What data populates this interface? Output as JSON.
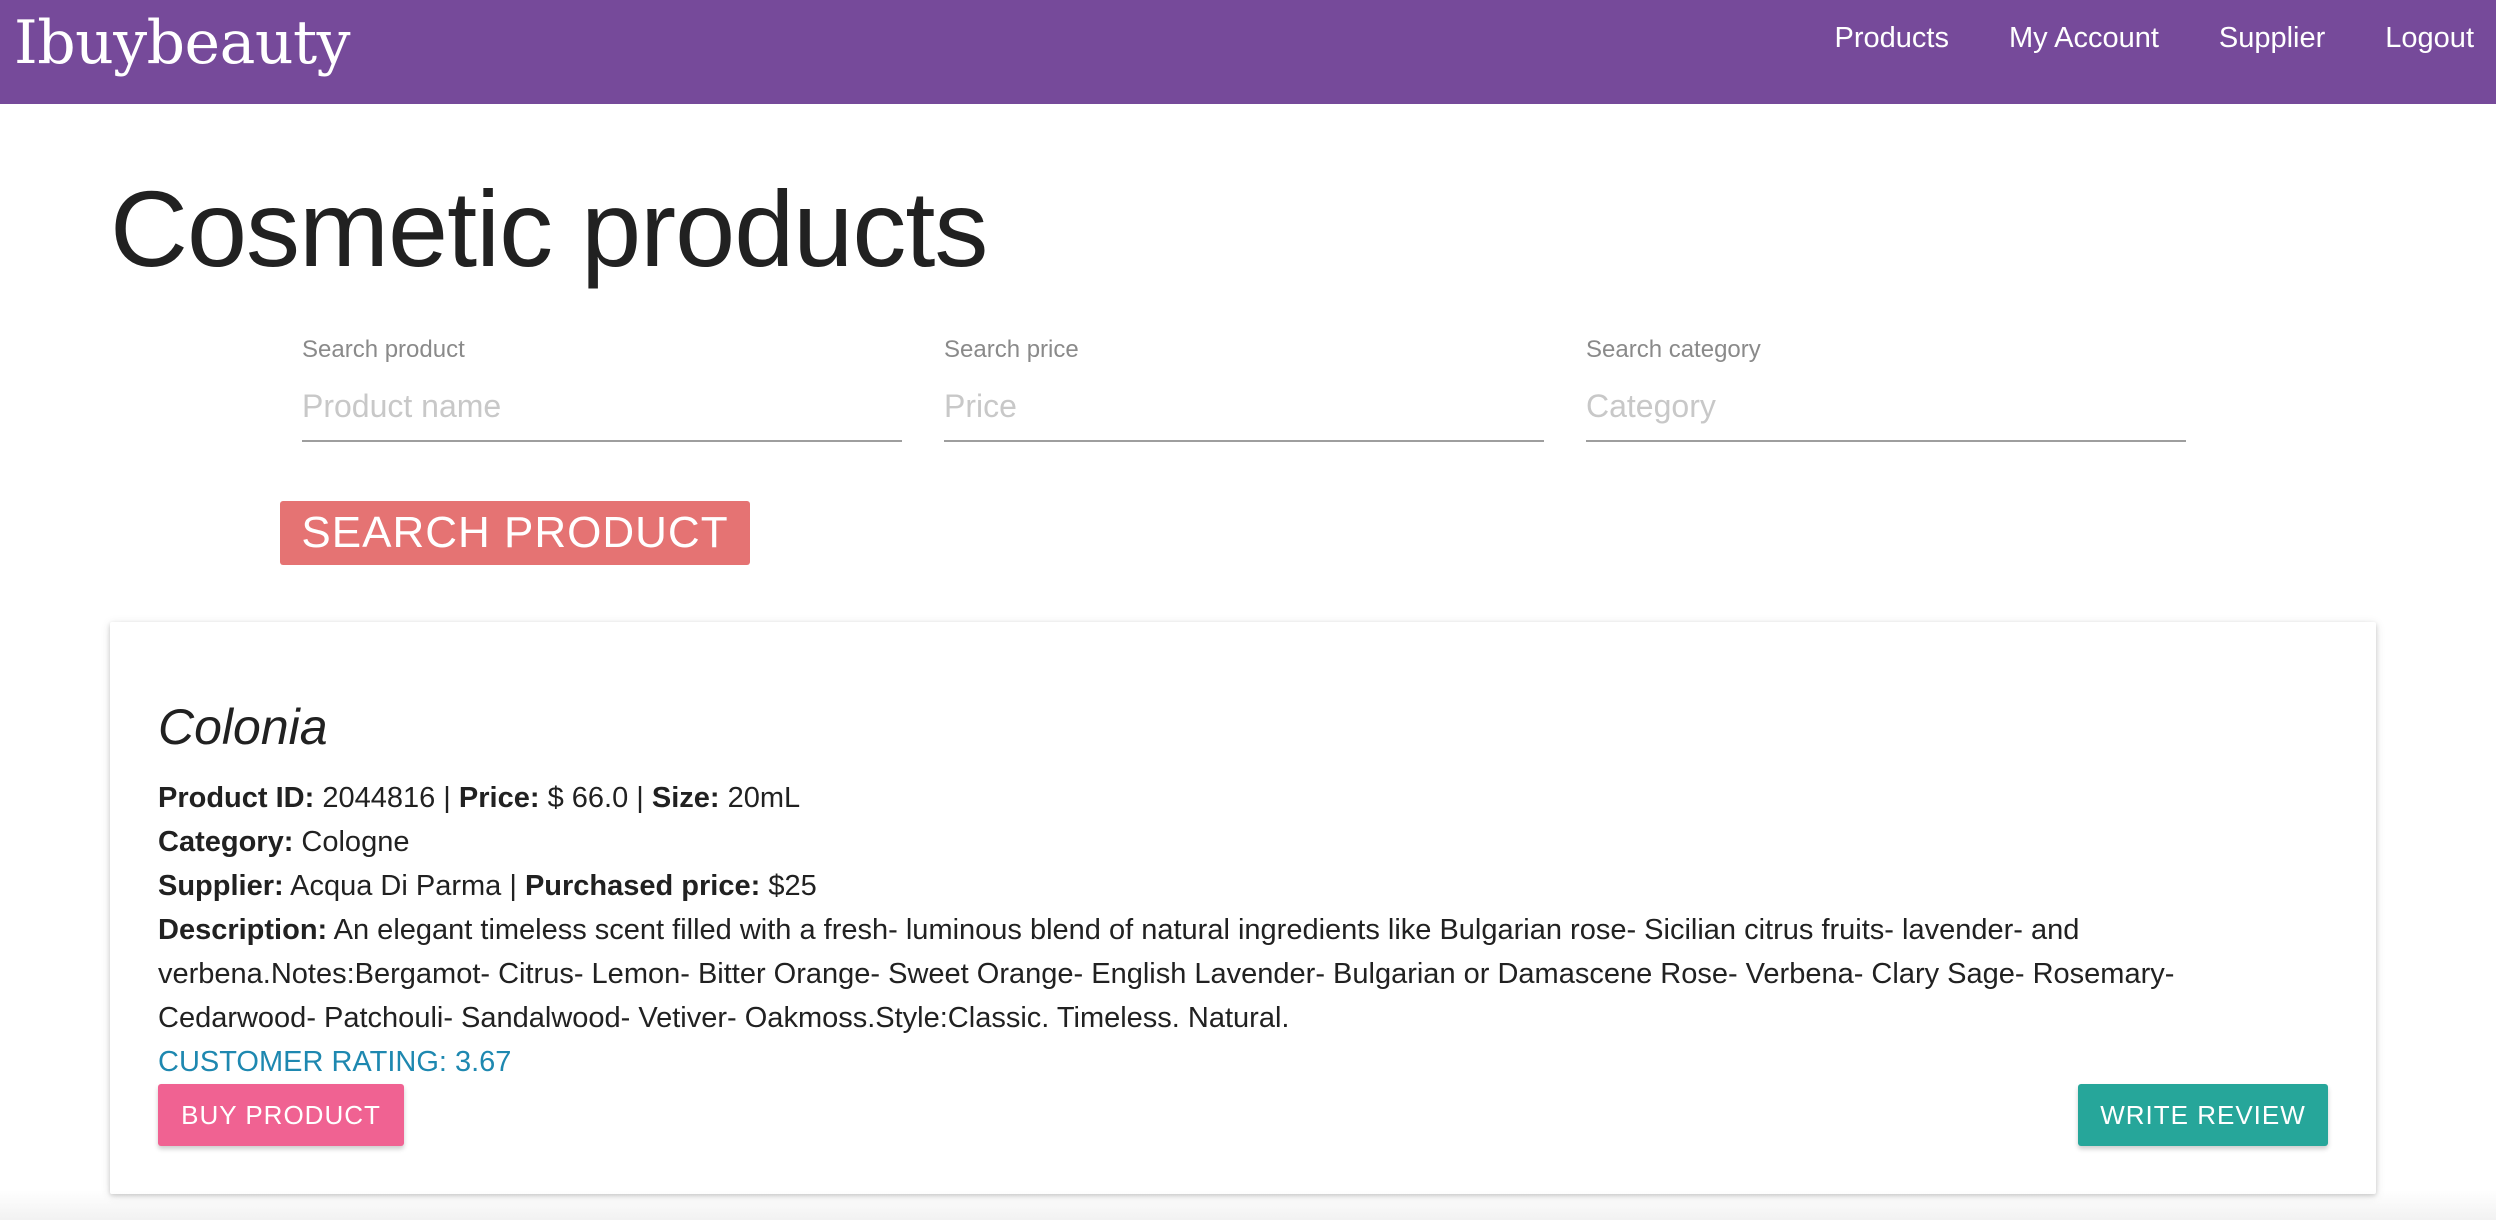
{
  "navbar": {
    "brand": "Ibuybeauty",
    "links": [
      "Products",
      "My Account",
      "Supplier",
      "Logout"
    ],
    "color": "#764a9a"
  },
  "page": {
    "title": "Cosmetic products"
  },
  "search": {
    "product_label": "Search product",
    "product_placeholder": "Product name",
    "price_label": "Search price",
    "price_placeholder": "Price",
    "category_label": "Search category",
    "category_placeholder": "Category",
    "button_label": "SEARCH PRODUCT"
  },
  "product": {
    "name": "Colonia",
    "id_label": "Product ID:",
    "id": "2044816",
    "price_label": "Price:",
    "price": "$ 66.0",
    "size_label": "Size:",
    "size": "20mL",
    "category_label": "Category:",
    "category": "Cologne",
    "supplier_label": "Supplier:",
    "supplier": "Acqua Di Parma",
    "purchased_label": "Purchased price:",
    "purchased_price": "$25",
    "description_label": "Description:",
    "description": "An elegant timeless scent filled with a fresh- luminous blend of natural ingredients like Bulgarian rose- Sicilian citrus fruits- lavender- and verbena.Notes:Bergamot- Citrus- Lemon- Bitter Orange- Sweet Orange- English Lavender- Bulgarian or Damascene Rose- Verbena- Clary Sage- Rosemary- Cedarwood- Patchouli- Sandalwood- Vetiver- Oakmoss.Style:Classic. Timeless. Natural.",
    "rating_text": "CUSTOMER RATING: 3.67",
    "buy_label": "BUY PRODUCT",
    "review_label": "WRITE REVIEW"
  },
  "colors": {
    "search_button": "#e57373",
    "buy_button": "#f06292",
    "review_button": "#26a69a",
    "rating_text": "#1e88b0"
  }
}
